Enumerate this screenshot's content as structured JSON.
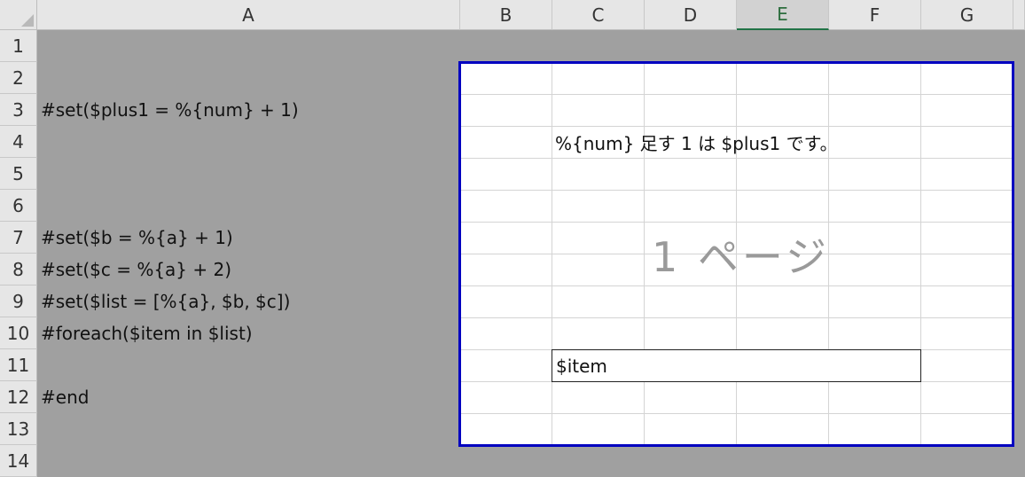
{
  "columns": [
    "A",
    "B",
    "C",
    "D",
    "E",
    "F",
    "G"
  ],
  "selected_column": "E",
  "rows": [
    "1",
    "2",
    "3",
    "4",
    "5",
    "6",
    "7",
    "8",
    "9",
    "10",
    "11",
    "12",
    "13",
    "14"
  ],
  "column_a": {
    "row3": "#set($plus1 = %{num} + 1)",
    "row7": "#set($b = %{a} + 1)",
    "row8": "#set($c = %{a} + 2)",
    "row9": "#set($list = [%{a}, $b, $c])",
    "row10": "#foreach($item in $list)",
    "row12": "#end"
  },
  "print_area": {
    "c4_text": "%{num} 足す 1 は $plus1 です。",
    "page_label": "1 ページ",
    "item_cell": "$item"
  },
  "colors": {
    "print_area_border": "#0000c0",
    "selected_header": "#217346",
    "outside_background": "#a0a0a0"
  }
}
